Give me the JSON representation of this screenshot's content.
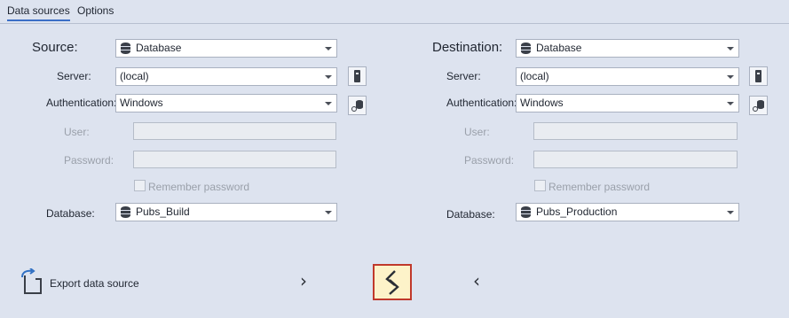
{
  "tabs": [
    {
      "label": "Data sources",
      "active": true
    },
    {
      "label": "Options",
      "active": false
    }
  ],
  "source": {
    "heading": "Source:",
    "type": "Database",
    "server_label": "Server:",
    "server": "(local)",
    "auth_label": "Authentication:",
    "auth": "Windows",
    "user_label": "User:",
    "user": "",
    "password_label": "Password:",
    "password": "",
    "remember_label": "Remember password",
    "remember_checked": false,
    "database_label": "Database:",
    "database": "Pubs_Build"
  },
  "destination": {
    "heading": "Destination:",
    "type": "Database",
    "server_label": "Server:",
    "server": "(local)",
    "auth_label": "Authentication:",
    "auth": "Windows",
    "user_label": "User:",
    "user": "",
    "password_label": "Password:",
    "password": "",
    "remember_label": "Remember password",
    "remember_checked": false,
    "database_label": "Database:",
    "database": "Pubs_Production"
  },
  "footer": {
    "export_label": "Export data source",
    "copy_right_glyph": "›",
    "copy_left_glyph": "‹"
  },
  "colors": {
    "background": "#dde3ef",
    "compare_border": "#c0392b",
    "compare_fill": "#fdf3c9"
  }
}
